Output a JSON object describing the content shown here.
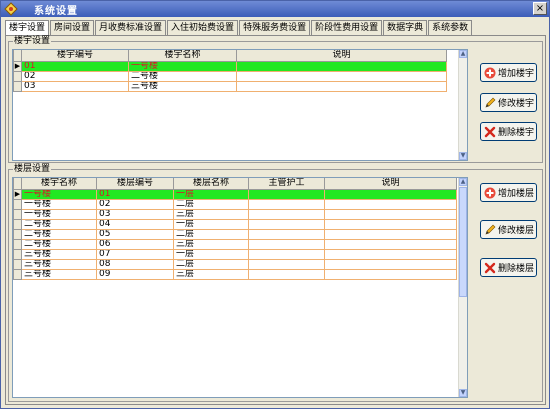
{
  "window": {
    "title": "系统设置",
    "close_label": "×"
  },
  "tabs": [
    {
      "label": "楼宇设置",
      "active": true
    },
    {
      "label": "房间设置"
    },
    {
      "label": "月收费标准设置"
    },
    {
      "label": "入住初始费设置"
    },
    {
      "label": "特殊服务费设置"
    },
    {
      "label": "阶段性费用设置"
    },
    {
      "label": "数据字典"
    },
    {
      "label": "系统参数"
    }
  ],
  "building_group": {
    "title": "楼宇设置",
    "columns": [
      "楼宇编号",
      "楼宇名称",
      "说明"
    ],
    "rows": [
      [
        "01",
        "一号楼",
        ""
      ],
      [
        "02",
        "二号楼",
        ""
      ],
      [
        "03",
        "三号楼",
        ""
      ]
    ],
    "selected_row": 0,
    "buttons": {
      "add": "增加楼宇",
      "edit": "修改楼宇",
      "delete": "删除楼宇"
    }
  },
  "floor_group": {
    "title": "楼层设置",
    "columns": [
      "楼宇名称",
      "楼层编号",
      "楼层名称",
      "主管护工",
      "说明"
    ],
    "rows": [
      [
        "一号楼",
        "01",
        "一层",
        "",
        ""
      ],
      [
        "一号楼",
        "02",
        "二层",
        "",
        ""
      ],
      [
        "一号楼",
        "03",
        "三层",
        "",
        ""
      ],
      [
        "二号楼",
        "04",
        "一层",
        "",
        ""
      ],
      [
        "二号楼",
        "05",
        "二层",
        "",
        ""
      ],
      [
        "二号楼",
        "06",
        "三层",
        "",
        ""
      ],
      [
        "三号楼",
        "07",
        "一层",
        "",
        ""
      ],
      [
        "三号楼",
        "08",
        "二层",
        "",
        ""
      ],
      [
        "三号楼",
        "09",
        "三层",
        "",
        ""
      ]
    ],
    "selected_row": 0,
    "buttons": {
      "add": "增加楼层",
      "edit": "修改楼层",
      "delete": "删除楼层"
    }
  },
  "icons": {
    "add": "plus-icon",
    "edit": "pencil-icon",
    "delete": "x-icon"
  },
  "colors": {
    "selected_row_bg": "#22e822",
    "selected_row_text": "#e0102a",
    "grid_line": "#f0b070",
    "title_bar": "#3c5db8"
  }
}
